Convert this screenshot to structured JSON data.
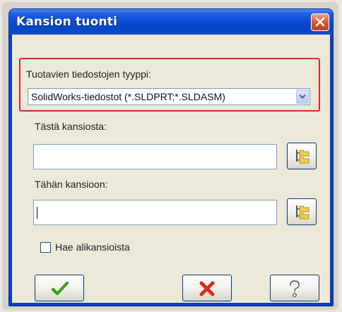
{
  "window": {
    "title": "Kansion tuonti"
  },
  "file_type": {
    "label": "Tuotavien tiedostojen tyyppi:",
    "selected": "SolidWorks-tiedostot (*.SLDPRT;*.SLDASM)"
  },
  "source": {
    "label": "Tästä kansiosta:",
    "value": ""
  },
  "target": {
    "label": "Tähän kansioon:",
    "value": ""
  },
  "subfolders": {
    "label": "Hae alikansioista",
    "checked": false
  },
  "colors": {
    "highlight": "#d9262e",
    "ok_check": "#3aa10f",
    "cancel_x": "#e02a1a",
    "titlebar": "#0a47d3"
  },
  "icons": {
    "close": "close-icon",
    "browse": "folder-tree-icon",
    "ok": "checkmark-icon",
    "cancel": "red-x-icon",
    "help": "question-mark-icon",
    "dropdown": "chevron-down-icon"
  }
}
